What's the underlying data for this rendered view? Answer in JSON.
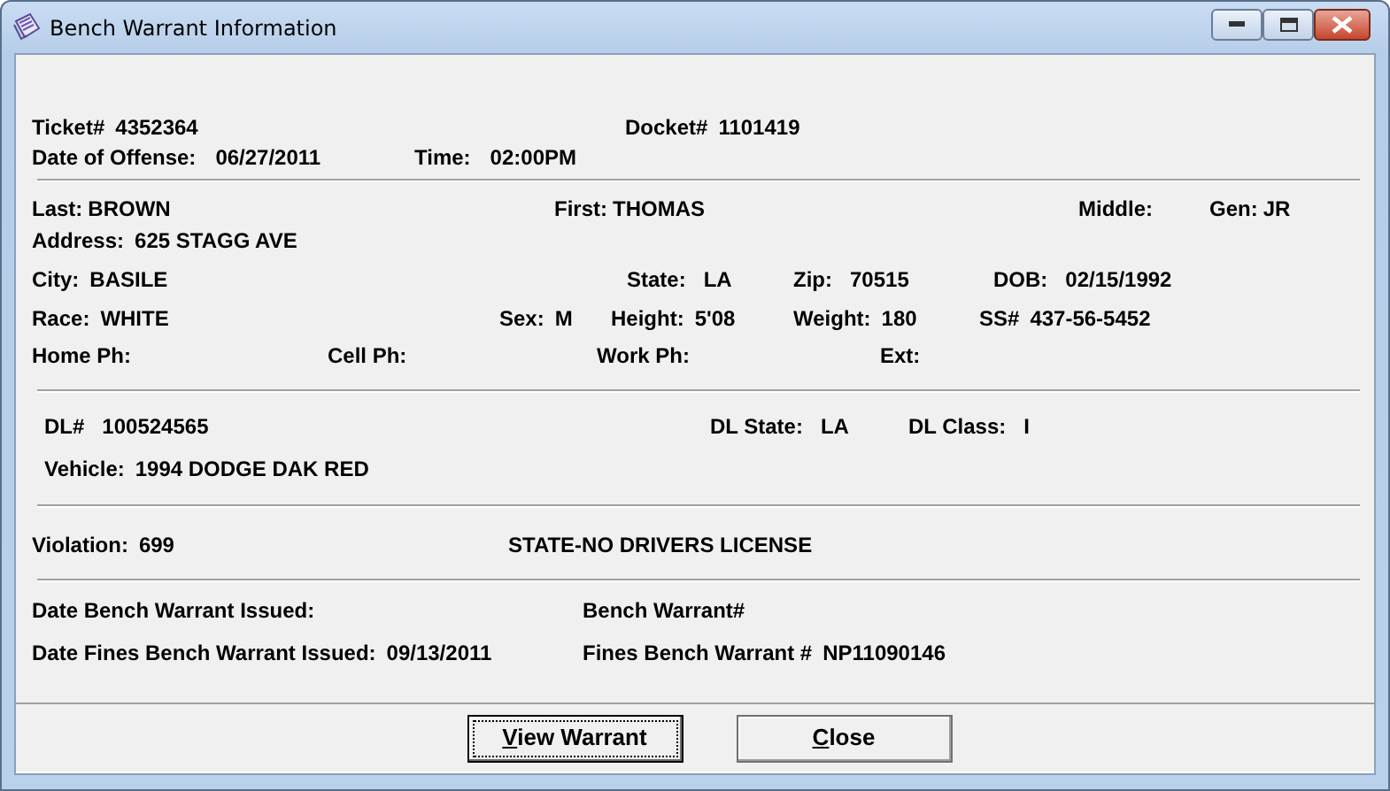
{
  "window": {
    "title": "Bench Warrant Information"
  },
  "sections": [
    {
      "rows": [
        {
          "fields": [
            {
              "label": "Ticket#",
              "value": "4352364"
            },
            {
              "label": "Docket#",
              "value": "1101419"
            }
          ]
        },
        {
          "fields": [
            {
              "label": "Date of Offense:",
              "value": "06/27/2011"
            },
            {
              "label": "Time:",
              "value": "02:00PM"
            }
          ]
        }
      ]
    },
    {
      "rows": [
        {
          "fields": [
            {
              "label": "Last:",
              "value": "BROWN"
            },
            {
              "label": "First:",
              "value": "THOMAS"
            },
            {
              "label": "Middle:"
            },
            {
              "label": "Gen:",
              "value": "JR"
            }
          ]
        },
        {
          "fields": [
            {
              "label": "Address:",
              "value": "625 STAGG AVE"
            }
          ]
        },
        {
          "fields": [
            {
              "label": "City:",
              "value": "BASILE"
            },
            {
              "label": "State:",
              "value": "LA"
            },
            {
              "label": "Zip:",
              "value": "70515"
            },
            {
              "label": "DOB:",
              "value": "02/15/1992"
            }
          ]
        },
        {
          "fields": [
            {
              "label": "Race:",
              "value": "WHITE"
            },
            {
              "label": "Sex:",
              "value": "M"
            },
            {
              "label": "Height:",
              "value": "5'08"
            },
            {
              "label": "Weight:",
              "value": "180"
            },
            {
              "label": "SS#",
              "value": "437-56-5452"
            }
          ]
        },
        {
          "fields": [
            {
              "label": "Home Ph:"
            },
            {
              "label": "Cell Ph:"
            },
            {
              "label": "Work Ph:"
            },
            {
              "label": "Ext:"
            }
          ]
        }
      ]
    },
    {
      "rows": [
        {
          "fields": [
            {
              "label": "DL#",
              "value": "100524565"
            },
            {
              "label": "DL State:",
              "value": "LA"
            },
            {
              "label": "DL Class:",
              "value": "I"
            }
          ]
        },
        {
          "fields": [
            {
              "label": "Vehicle:",
              "value": "1994 DODGE DAK RED"
            }
          ]
        }
      ]
    },
    {
      "rows": [
        {
          "fields": [
            {
              "label": "Violation:",
              "value": "699"
            },
            {
              "value": "STATE-NO DRIVERS LICENSE"
            }
          ]
        }
      ]
    },
    {
      "rows": [
        {
          "fields": [
            {
              "label": "Date Bench Warrant Issued:"
            },
            {
              "label": "Bench Warrant#"
            }
          ]
        },
        {
          "fields": [
            {
              "label": "Date Fines Bench Warrant Issued:",
              "value": "09/13/2011"
            },
            {
              "label": "Fines Bench Warrant #",
              "value": "NP11090146"
            }
          ]
        }
      ]
    }
  ],
  "buttons": [
    {
      "label": "View Warrant",
      "focused": true,
      "underline_first": true
    },
    {
      "label": "Close",
      "focused": false,
      "underline_first": true
    }
  ]
}
